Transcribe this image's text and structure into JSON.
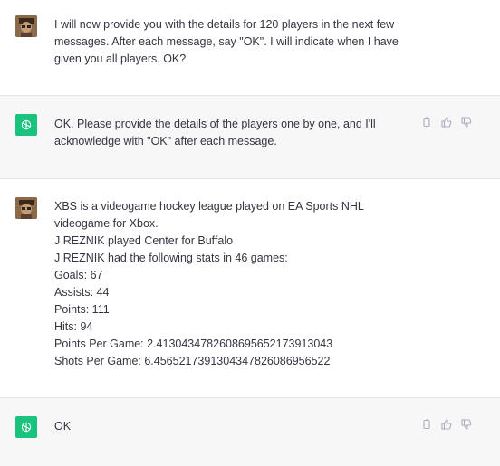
{
  "messages": [
    {
      "role": "user",
      "avatar": "user-photo",
      "lines": [
        "I will now provide you with the details for 120 players in the next few",
        "messages.  After each message, say \"OK\".  I will indicate when I have",
        "given you all players.  OK?"
      ]
    },
    {
      "role": "assistant",
      "avatar": "chatgpt-logo-icon",
      "lines": [
        "OK. Please provide the details of the players one by one, and I'll",
        "acknowledge with \"OK\" after each message."
      ]
    },
    {
      "role": "user",
      "avatar": "user-photo",
      "lines": [
        "XBS is a videogame hockey league played on EA Sports NHL",
        "videogame for Xbox.",
        "J REZNIK played Center for Buffalo",
        "J REZNIK had the following stats in 46 games:",
        "Goals: 67",
        "Assists: 44",
        "Points: 111",
        "Hits: 94",
        "Points Per Game: 2.4130434782608695652173913043",
        "Shots Per Game: 6.4565217391304347826086956522"
      ]
    },
    {
      "role": "assistant",
      "avatar": "chatgpt-logo-icon",
      "lines": [
        "OK"
      ]
    }
  ],
  "action_icons": [
    "copy-icon",
    "thumbs-up-icon",
    "thumbs-down-icon"
  ],
  "colors": {
    "assistant_bg": "#f7f7f8",
    "logo_green": "#19c37d",
    "text": "#343541",
    "icon": "#acacbe"
  }
}
